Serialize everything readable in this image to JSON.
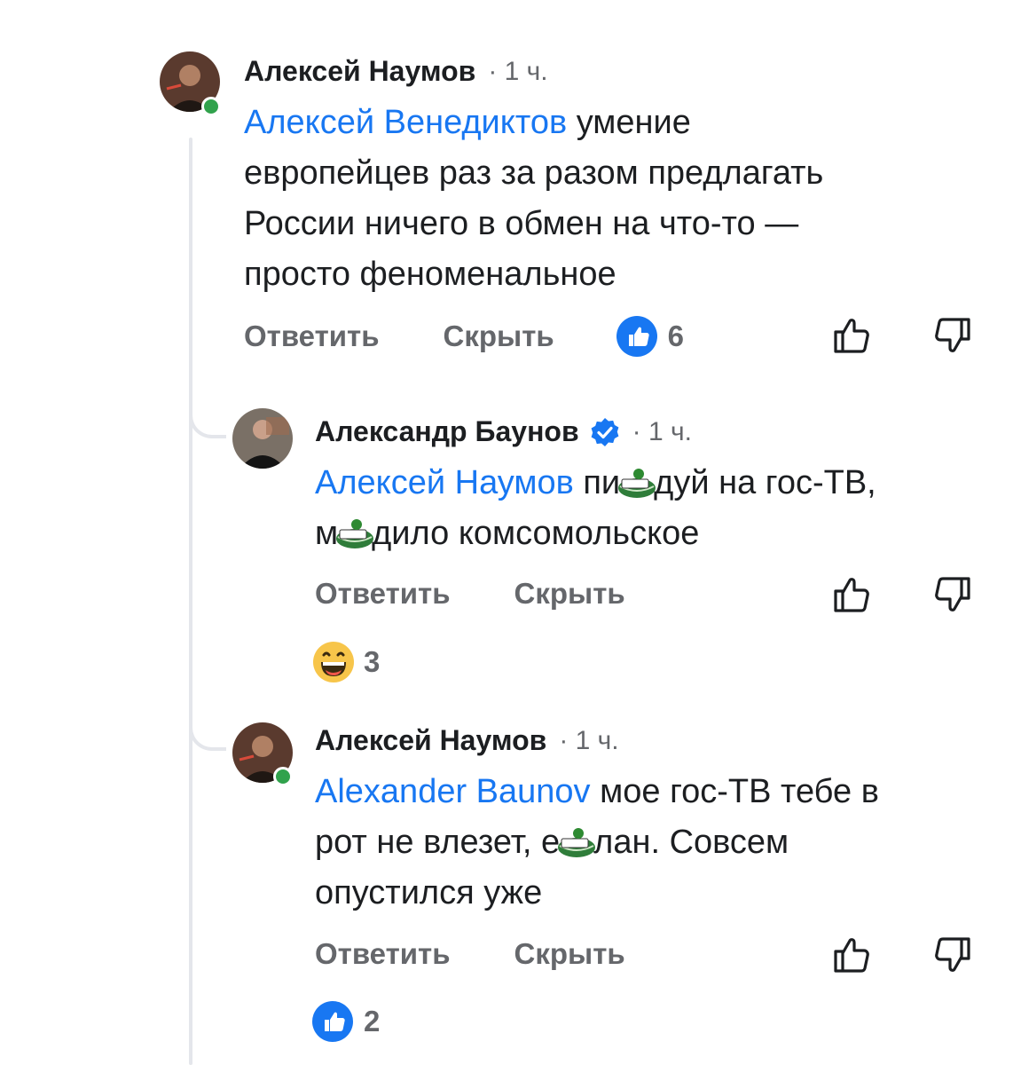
{
  "comments": [
    {
      "author": "Алексей Наумов",
      "time": "1 ч.",
      "mention": "Алексей Венедиктов",
      "text_line1_after": " умение",
      "text_line2": "европейцев раз за разом предлагать",
      "text_line3": "России ничего в обмен на что-то —",
      "text_line4": "просто феноменальное",
      "reply_label": "Ответить",
      "hide_label": "Скрыть",
      "likes": "6",
      "online": true
    },
    {
      "author": "Александр Баунов",
      "verified": true,
      "time": "1 ч.",
      "mention": "Алексей Наумов",
      "line1_a": " пи",
      "line1_b": "дуй на гос-ТВ,",
      "line2_a": "м",
      "line2_b": "дило комсомольское",
      "reply_label": "Ответить",
      "hide_label": "Скрыть",
      "reaction": "haha",
      "reaction_count": "3"
    },
    {
      "author": "Алексей Наумов",
      "time": "1 ч.",
      "mention": "Alexander Baunov",
      "line1_after": " мое гос-ТВ тебе в",
      "line2_a": "рот не влезет, е",
      "line2_b": "лан. Совсем",
      "line3": "опустился уже",
      "reply_label": "Ответить",
      "hide_label": "Скрыть",
      "reaction": "like",
      "reaction_count": "2",
      "online": true
    }
  ],
  "colors": {
    "link": "#1877f2",
    "online": "#31a24c",
    "muted": "#65676b"
  }
}
